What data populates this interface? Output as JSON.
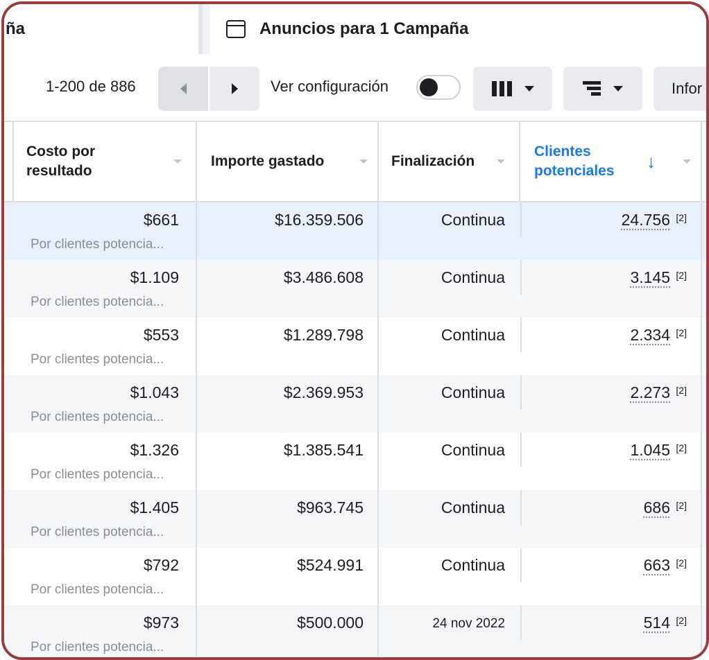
{
  "tabs": {
    "left_label": "ña",
    "right_label": "Anuncios para 1 Campaña"
  },
  "toolbar": {
    "pager": "1-200 de 886",
    "ver_config_label": "Ver configuración",
    "info_label": "Infor"
  },
  "columns": {
    "cost": "Costo por resultado",
    "importe": "Importe gastado",
    "finalizacion": "Finalización",
    "clientes": "Clientes potenciales"
  },
  "rows": [
    {
      "cost": "$661",
      "cost_sub": "Por clientes potencia...",
      "importe": "$16.359.506",
      "fin": "Continua",
      "clientes": "24.756",
      "note": "[2]"
    },
    {
      "cost": "$1.109",
      "cost_sub": "Por clientes potencia...",
      "importe": "$3.486.608",
      "fin": "Continua",
      "clientes": "3.145",
      "note": "[2]"
    },
    {
      "cost": "$553",
      "cost_sub": "Por clientes potencia...",
      "importe": "$1.289.798",
      "fin": "Continua",
      "clientes": "2.334",
      "note": "[2]"
    },
    {
      "cost": "$1.043",
      "cost_sub": "Por clientes potencia...",
      "importe": "$2.369.953",
      "fin": "Continua",
      "clientes": "2.273",
      "note": "[2]"
    },
    {
      "cost": "$1.326",
      "cost_sub": "Por clientes potencia...",
      "importe": "$1.385.541",
      "fin": "Continua",
      "clientes": "1.045",
      "note": "[2]"
    },
    {
      "cost": "$1.405",
      "cost_sub": "Por clientes potencia...",
      "importe": "$963.745",
      "fin": "Continua",
      "clientes": "686",
      "note": "[2]"
    },
    {
      "cost": "$792",
      "cost_sub": "Por clientes potencia...",
      "importe": "$524.991",
      "fin": "Continua",
      "clientes": "663",
      "note": "[2]"
    },
    {
      "cost": "$973",
      "cost_sub": "Por clientes potencia...",
      "importe": "$500.000",
      "fin": "24 nov 2022",
      "clientes": "514",
      "note": "[2]"
    }
  ],
  "colors": {
    "accent": "#1877f2",
    "frame": "#9a3c3c",
    "row_selected": "#e7f0fd",
    "row_alt": "#f5f6f7"
  }
}
